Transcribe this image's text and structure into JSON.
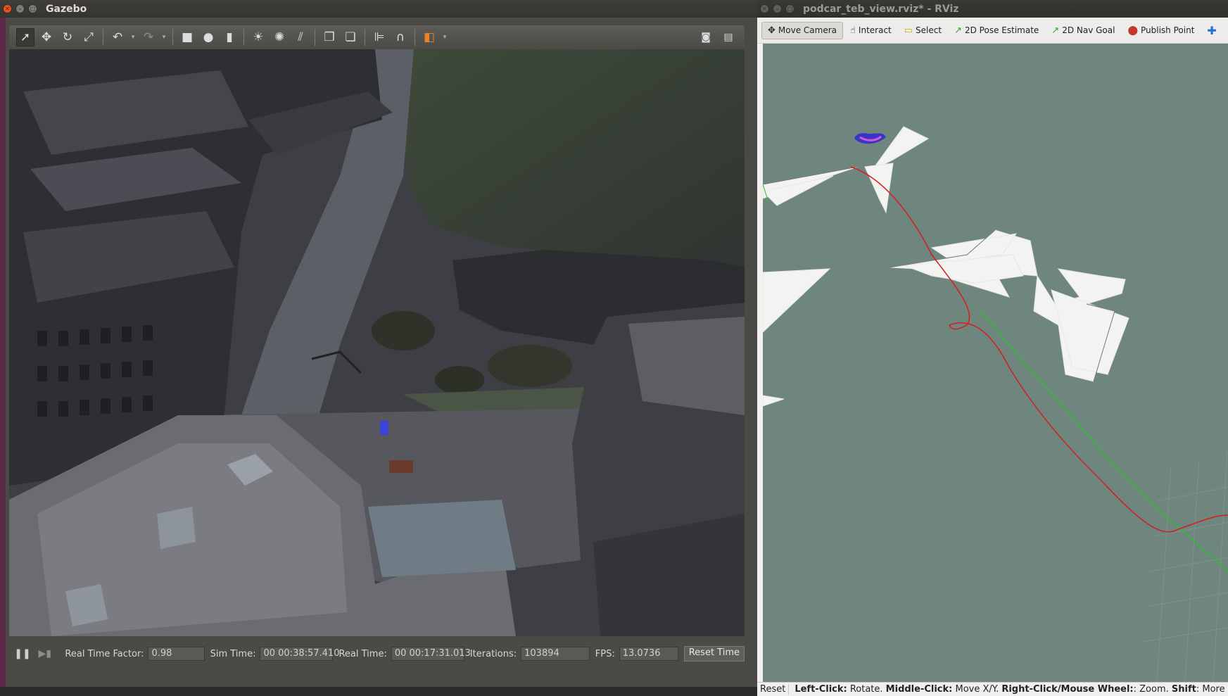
{
  "gazebo": {
    "title": "Gazebo",
    "toolbar": {
      "tools": [
        "select-arrow-icon",
        "translate-icon",
        "rotate-icon",
        "scale-icon"
      ],
      "camera_icon": "camera-icon",
      "save_icon": "save-icon"
    },
    "status": {
      "real_time_factor_label": "Real Time Factor:",
      "real_time_factor_value": "0.98",
      "sim_time_label": "Sim Time:",
      "sim_time_value": "00 00:38:57.410",
      "real_time_label": "Real Time:",
      "real_time_value": "00 00:17:31.013",
      "iterations_label": "Iterations:",
      "iterations_value": "103894",
      "fps_label": "FPS:",
      "fps_value": "13.0736",
      "reset_time_label": "Reset Time"
    }
  },
  "rviz": {
    "title": "podcar_teb_view.rviz* - RViz",
    "toolbar": {
      "move_camera": "Move Camera",
      "interact": "Interact",
      "select": "Select",
      "pose_estimate": "2D Pose Estimate",
      "nav_goal": "2D Nav Goal",
      "publish_point": "Publish Point"
    },
    "status": {
      "reset": "Reset",
      "left_click_key": "Left-Click:",
      "left_click_val": " Rotate. ",
      "middle_click_key": "Middle-Click:",
      "middle_click_val": " Move X/Y. ",
      "right_click_key": "Right-Click/Mouse Wheel:",
      "right_click_val": ": Zoom. ",
      "shift_key": "Shift",
      "shift_val": ": More optic"
    },
    "colors": {
      "background": "#6f867e",
      "path_red": "#d21f1f",
      "path_green": "#2fbf2f",
      "robot_blue": "#3a35c9"
    }
  }
}
